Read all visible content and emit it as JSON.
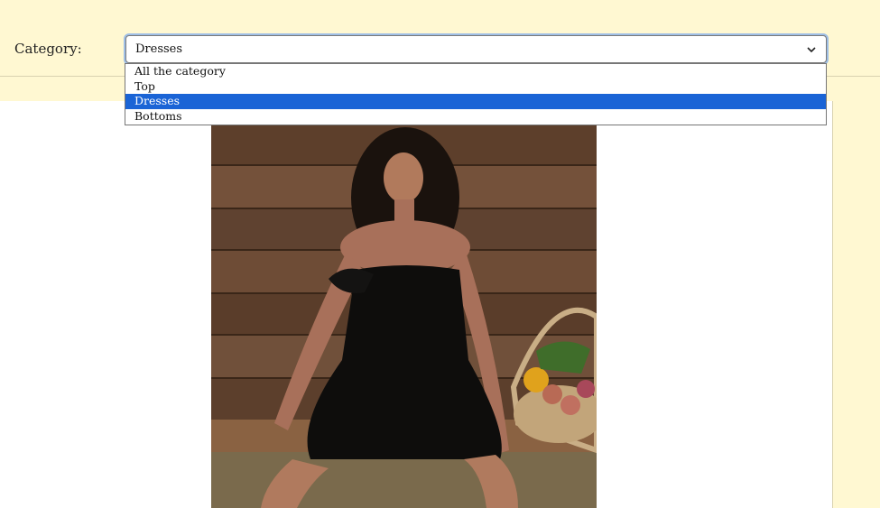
{
  "filter": {
    "label": "Category:",
    "selected_value": "Dresses",
    "options": [
      "All the category",
      "Top",
      "Dresses",
      "Bottoms"
    ],
    "selected_index": 2
  },
  "product": {
    "image_icon": "product-photo"
  },
  "colors": {
    "page_background": "#fff8d2",
    "selection_highlight": "#1a64d6"
  }
}
